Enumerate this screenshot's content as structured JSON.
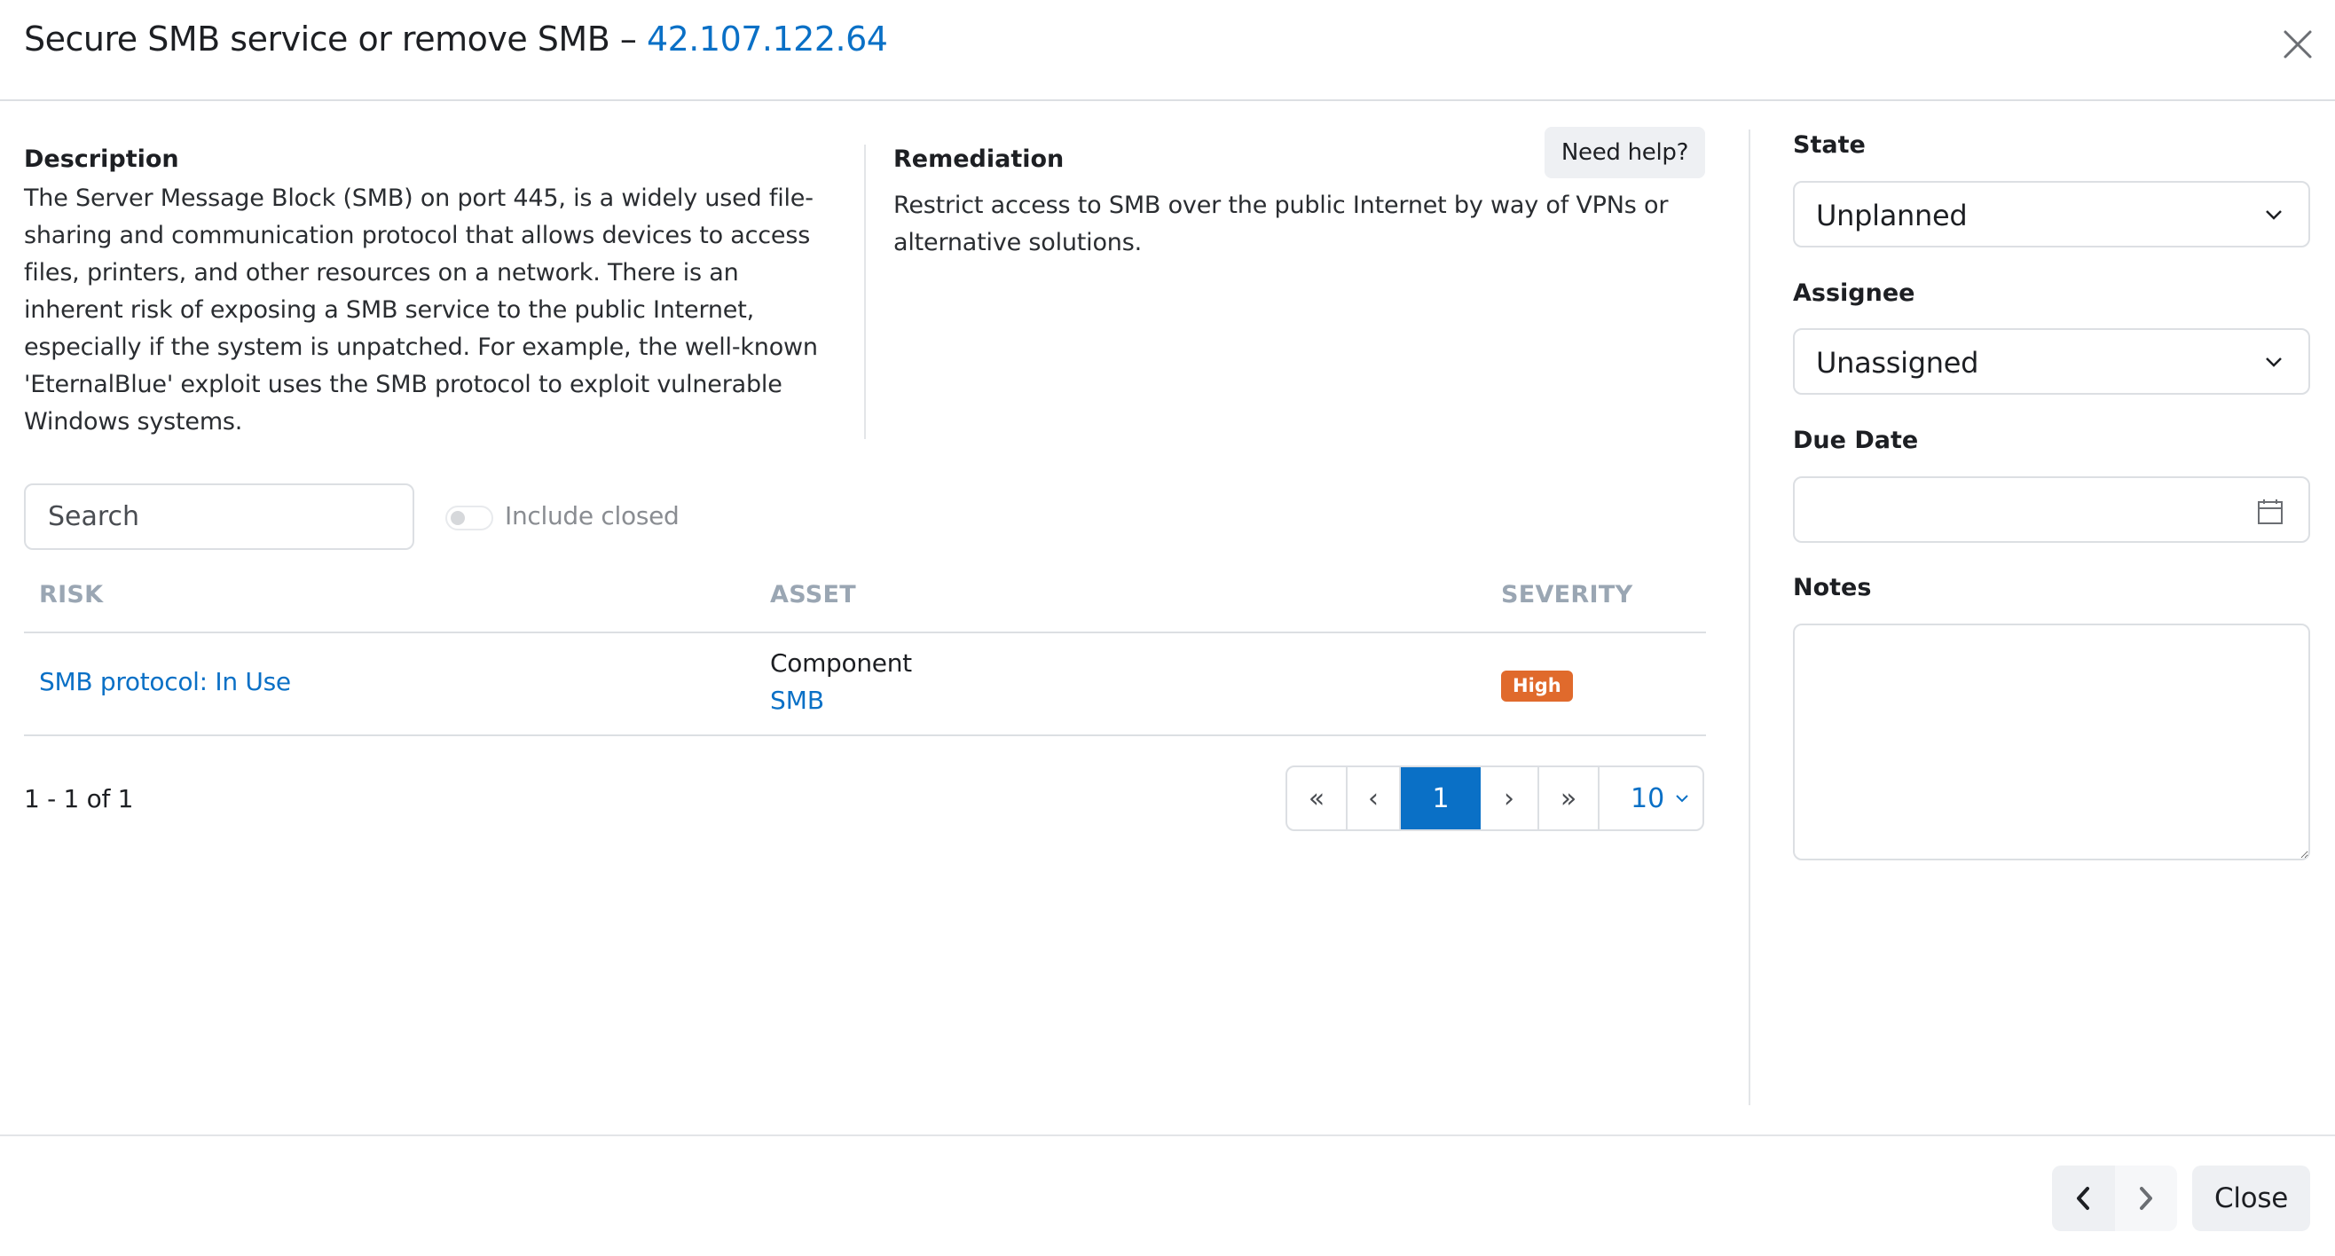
{
  "header": {
    "title": "Secure SMB service or remove SMB – ",
    "ip_link": "42.107.122.64",
    "close_icon": "close-x-icon"
  },
  "description": {
    "heading": "Description",
    "body": "The Server Message Block (SMB) on port 445, is a widely used file-sharing and communication protocol that allows devices to access files, printers, and other resources on a network. There is an inherent risk of exposing a SMB service to the public Internet, especially if the system is unpatched. For example, the well-known 'EternalBlue' exploit uses the SMB protocol to exploit vulnerable Windows systems."
  },
  "remediation": {
    "heading": "Remediation",
    "body": "Restrict access to SMB over the public Internet by way of VPNs or alternative solutions.",
    "help_button": "Need help?"
  },
  "filters": {
    "search_placeholder": "Search",
    "search_value": "",
    "include_closed_label": "Include closed",
    "include_closed_on": false
  },
  "table": {
    "columns": [
      "RISK",
      "ASSET",
      "SEVERITY"
    ],
    "rows": [
      {
        "risk": "SMB protocol: In Use",
        "asset_type": "Component",
        "asset_name": "SMB",
        "severity": "High",
        "severity_color": "#e06a2c"
      }
    ]
  },
  "pagination": {
    "summary": "1 - 1 of 1",
    "first": "«",
    "prev": "‹",
    "current_page": "1",
    "next": "›",
    "last": "»",
    "page_size": "10"
  },
  "side_panel": {
    "state_label": "State",
    "state_value": "Unplanned",
    "assignee_label": "Assignee",
    "assignee_value": "Unassigned",
    "due_date_label": "Due Date",
    "due_date_value": "",
    "notes_label": "Notes",
    "notes_value": ""
  },
  "footer": {
    "prev_icon": "chevron-left-icon",
    "next_icon": "chevron-right-icon",
    "close_label": "Close"
  },
  "colors": {
    "accent": "#0a70c6",
    "severity_high": "#e06a2c",
    "border": "#dcdfe3",
    "header_muted": "#9aa6b3"
  }
}
